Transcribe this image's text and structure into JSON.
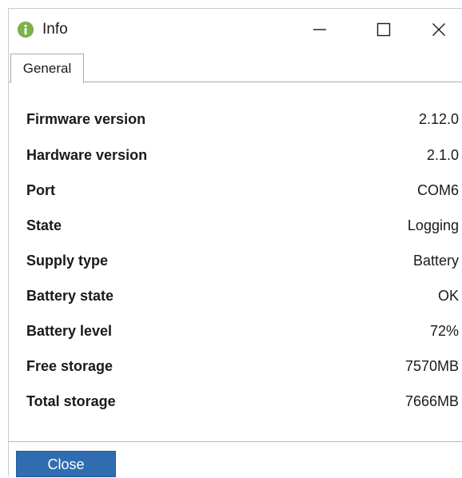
{
  "window": {
    "title": "Info",
    "icon": "info-icon",
    "accent": "#7cb24a"
  },
  "tabs": [
    {
      "label": "General",
      "active": true
    }
  ],
  "info_rows": [
    {
      "label": "Firmware version",
      "value": "2.12.0"
    },
    {
      "label": "Hardware version",
      "value": "2.1.0"
    },
    {
      "label": "Port",
      "value": "COM6"
    },
    {
      "label": "State",
      "value": "Logging"
    },
    {
      "label": "Supply type",
      "value": "Battery"
    },
    {
      "label": "Battery state",
      "value": "OK"
    },
    {
      "label": "Battery level",
      "value": "72%"
    },
    {
      "label": "Free storage",
      "value": "7570MB"
    },
    {
      "label": "Total storage",
      "value": "7666MB"
    }
  ],
  "footer": {
    "close_label": "Close",
    "button_color": "#2f6db0"
  }
}
